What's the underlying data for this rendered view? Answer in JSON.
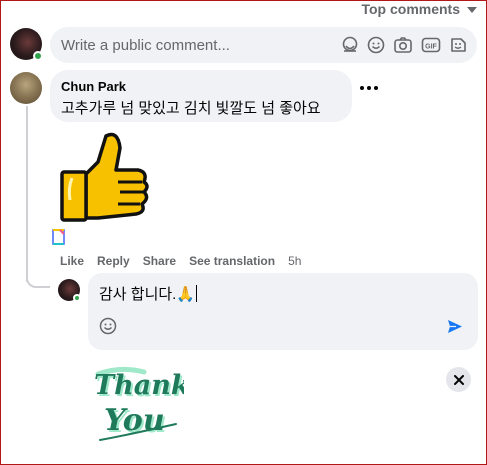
{
  "header": {
    "sort_label": "Top comments"
  },
  "comment_input": {
    "placeholder": "Write a public comment...",
    "icons": [
      "sticker-avatar-icon",
      "emoji-icon",
      "camera-icon",
      "gif-icon",
      "sticker-icon"
    ]
  },
  "comment": {
    "author": "Chun Park",
    "text": "고추가루 넘 맞있고 김치 빛깔도 넘 좋아요",
    "sticker": "thumbs-up-sticker",
    "actions": {
      "like": "Like",
      "reply": "Reply",
      "share": "Share",
      "translate": "See translation",
      "time": "5h"
    }
  },
  "reply": {
    "text": "감사 합니다.🙏",
    "attachment": "thank-you-sticker",
    "attachment_text_1": "Thank",
    "attachment_text_2": "You"
  },
  "colors": {
    "accent": "#1877f2",
    "online": "#31a24c",
    "thankyou": "#1f7a5c"
  }
}
